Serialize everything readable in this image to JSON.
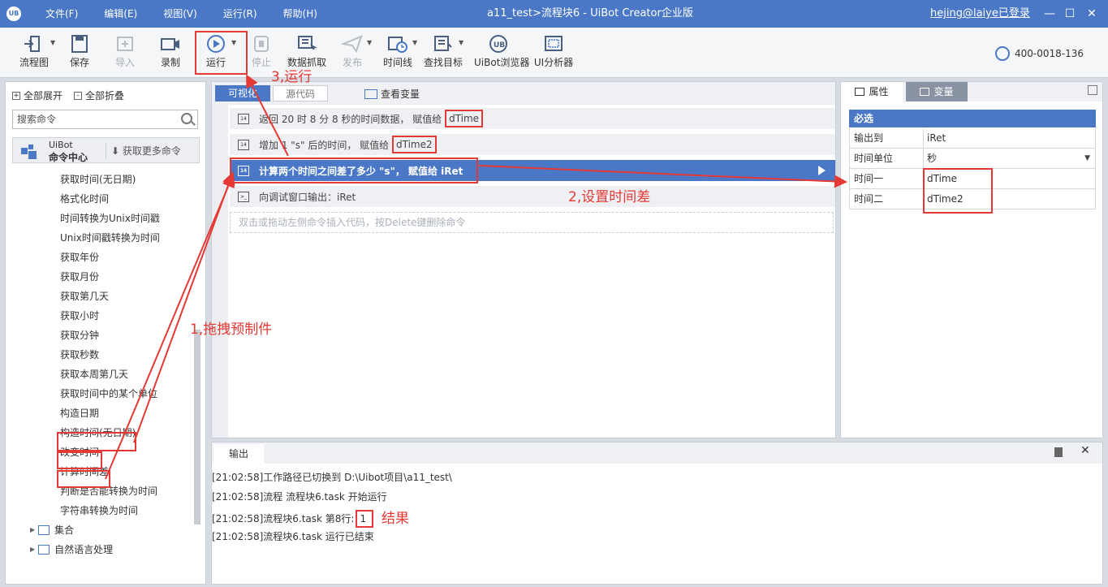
{
  "app": {
    "logo": "UB",
    "menu": [
      "文件(F)",
      "编辑(E)",
      "视图(V)",
      "运行(R)",
      "帮助(H)"
    ],
    "title": "a11_test>流程块6 - UiBot Creator企业版",
    "user": "hejing@laiye已登录"
  },
  "toolbar": {
    "items": [
      "流程图",
      "保存",
      "导入",
      "录制",
      "运行",
      "停止",
      "数据抓取",
      "发布",
      "时间线",
      "查找目标",
      "UiBot浏览器",
      "UI分析器"
    ],
    "phone": "400-0018-136"
  },
  "left": {
    "expand_all": "全部展开",
    "collapse_all": "全部折叠",
    "search_placeholder": "搜索命令",
    "center_t1": "UiBot",
    "center_t2": "命令中心",
    "more": "获取更多命令",
    "items": [
      "获取时间(无日期)",
      "格式化时间",
      "时间转换为Unix时间戳",
      "Unix时间戳转换为时间",
      "获取年份",
      "获取月份",
      "获取第几天",
      "获取小时",
      "获取分钟",
      "获取秒数",
      "获取本周第几天",
      "获取时间中的某个单位",
      "构造日期",
      "构造时间(无日期)",
      "改变时间",
      "计算时间差",
      "判断是否能转换为时间",
      "字符串转换为时间"
    ],
    "groups": [
      "集合",
      "自然语言处理"
    ]
  },
  "editor": {
    "tab_visual": "可视化",
    "tab_source": "源代码",
    "view_vars": "查看变量",
    "rows": [
      {
        "text": "返回 20 时 8 分 8 秒的时间数据， 赋值给",
        "var": "dTime"
      },
      {
        "text": "增加 1 \"s\" 后的时间， 赋值给",
        "var": "dTime2"
      },
      {
        "text": "计算两个时间之间差了多少 \"s\"， 赋值给 iRet",
        "var": ""
      },
      {
        "text": "向调试窗口输出：iRet",
        "var": ""
      }
    ],
    "drop_hint": "双击或拖动左侧命令插入代码，按Delete键删除命令"
  },
  "right": {
    "tab_props": "属性",
    "tab_vars": "变量",
    "section": "必选",
    "props": [
      {
        "k": "输出到",
        "v": "iRet"
      },
      {
        "k": "时间单位",
        "v": "秒"
      },
      {
        "k": "时间一",
        "v": "dTime"
      },
      {
        "k": "时间二",
        "v": "dTime2"
      }
    ]
  },
  "output": {
    "tab": "输出",
    "lines": [
      "[21:02:58]工作路径已切换到 D:\\Uibot项目\\a11_test\\",
      "[21:02:58]流程 流程块6.task 开始运行",
      "[21:02:58]流程块6.task 第8行:",
      "[21:02:58]流程块6.task 运行已结束"
    ],
    "result_value": "1"
  },
  "annotations": {
    "a1": "1,拖拽预制件",
    "a2": "2,设置时间差",
    "a3": "3,运行",
    "a4": "结果"
  },
  "colors": {
    "accent": "#4a78c7",
    "annotation": "#e53935"
  }
}
